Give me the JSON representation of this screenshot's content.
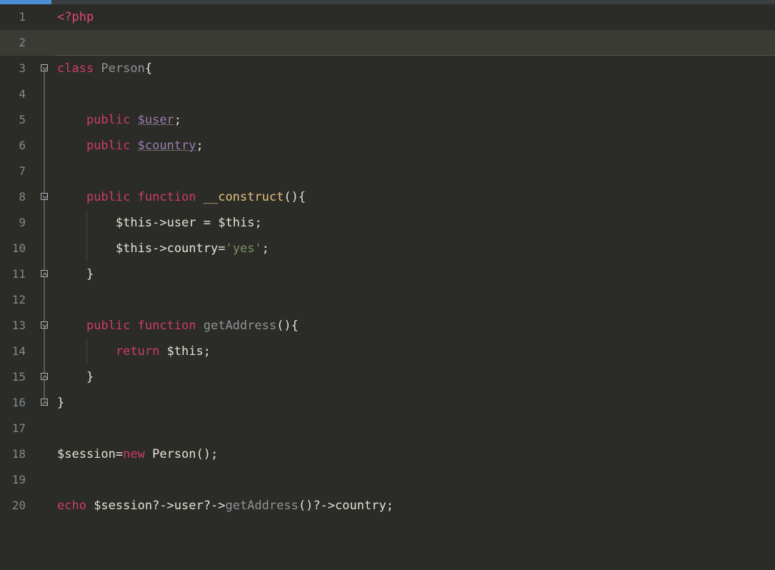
{
  "colors": {
    "background": "#2b2b27",
    "current_line": "#3b3b36",
    "gutter_text": "#7e8a8f",
    "keyword": "#cc3c6d",
    "tag": "#e24a77",
    "type": "#8f9396",
    "func": "#e6c17c",
    "string": "#7a9264",
    "text": "#e6e1d6",
    "top_strip_blue": "#4C8FD6",
    "top_strip_grey": "#3a3f41"
  },
  "current_line": 2,
  "lines": {
    "1": {
      "num": "1",
      "indent": 0,
      "fold": null,
      "segments": [
        [
          "<?php",
          "tag"
        ]
      ]
    },
    "2": {
      "num": "2",
      "indent": 0,
      "fold": null,
      "segments": []
    },
    "3": {
      "num": "3",
      "indent": 0,
      "fold": "open",
      "segments": [
        [
          "class ",
          "keyword"
        ],
        [
          "Person",
          "type"
        ],
        [
          "{",
          "brace"
        ]
      ]
    },
    "4": {
      "num": "4",
      "indent": 0,
      "fold": "line",
      "segments": []
    },
    "5": {
      "num": "5",
      "indent": 1,
      "fold": "line",
      "segments": [
        [
          "public ",
          "keyword"
        ],
        [
          "$user",
          "member"
        ],
        [
          ";",
          "op"
        ]
      ]
    },
    "6": {
      "num": "6",
      "indent": 1,
      "fold": "line",
      "segments": [
        [
          "public ",
          "keyword"
        ],
        [
          "$country",
          "member"
        ],
        [
          ";",
          "op"
        ]
      ]
    },
    "7": {
      "num": "7",
      "indent": 0,
      "fold": "line",
      "segments": []
    },
    "8": {
      "num": "8",
      "indent": 1,
      "fold": "open",
      "segments": [
        [
          "public ",
          "keyword"
        ],
        [
          "function ",
          "keyword"
        ],
        [
          "__construct",
          "func"
        ],
        [
          "(){",
          "brace"
        ]
      ]
    },
    "9": {
      "num": "9",
      "indent": 2,
      "fold": "line",
      "segments": [
        [
          "$this",
          "var"
        ],
        [
          "->",
          "op"
        ],
        [
          "user",
          "var"
        ],
        " = ",
        [
          "$this",
          "var"
        ],
        [
          ";",
          "op"
        ]
      ]
    },
    "10": {
      "num": "10",
      "indent": 2,
      "fold": "line",
      "segments": [
        [
          "$this",
          "var"
        ],
        [
          "->",
          "op"
        ],
        [
          "country",
          "var"
        ],
        [
          "=",
          "op"
        ],
        [
          "'yes'",
          "string"
        ],
        [
          ";",
          "op"
        ]
      ]
    },
    "11": {
      "num": "11",
      "indent": 1,
      "fold": "close",
      "segments": [
        [
          "}",
          "brace"
        ]
      ]
    },
    "12": {
      "num": "12",
      "indent": 0,
      "fold": "line",
      "segments": []
    },
    "13": {
      "num": "13",
      "indent": 1,
      "fold": "open",
      "segments": [
        [
          "public ",
          "keyword"
        ],
        [
          "function ",
          "keyword"
        ],
        [
          "getAddress",
          "method"
        ],
        [
          "(){",
          "brace"
        ]
      ]
    },
    "14": {
      "num": "14",
      "indent": 2,
      "fold": "line",
      "segments": [
        [
          "return ",
          "keyword"
        ],
        [
          "$this",
          "var"
        ],
        [
          ";",
          "op"
        ]
      ]
    },
    "15": {
      "num": "15",
      "indent": 1,
      "fold": "close",
      "segments": [
        [
          "}",
          "brace"
        ]
      ]
    },
    "16": {
      "num": "16",
      "indent": 0,
      "fold": "close",
      "segments": [
        [
          "}",
          "brace"
        ]
      ]
    },
    "17": {
      "num": "17",
      "indent": 0,
      "fold": null,
      "segments": []
    },
    "18": {
      "num": "18",
      "indent": 0,
      "fold": null,
      "segments": [
        [
          "$session",
          "var"
        ],
        [
          "=",
          "op"
        ],
        [
          "new ",
          "keyword"
        ],
        [
          "Person",
          "var"
        ],
        [
          "();",
          "op"
        ]
      ]
    },
    "19": {
      "num": "19",
      "indent": 0,
      "fold": null,
      "segments": []
    },
    "20": {
      "num": "20",
      "indent": 0,
      "fold": null,
      "segments": [
        [
          "echo ",
          "keyword"
        ],
        [
          "$session",
          "var"
        ],
        [
          "?->",
          "op"
        ],
        [
          "user",
          "var"
        ],
        [
          "?->",
          "op"
        ],
        [
          "getAddress",
          "method"
        ],
        [
          "()",
          "op"
        ],
        [
          "?->",
          "op"
        ],
        [
          "country",
          "var"
        ],
        [
          ";",
          "op"
        ]
      ]
    }
  },
  "icons": {
    "chrome": "chrome"
  }
}
